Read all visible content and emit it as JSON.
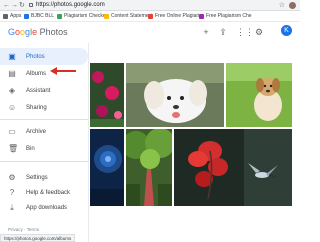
{
  "browser": {
    "url": "https://photos.google.com",
    "bookmarks": [
      {
        "label": "Apps",
        "color": "#5f6368"
      },
      {
        "label": "BJBC BLL",
        "color": "#1a73e8"
      },
      {
        "label": "Plagiarism Checker",
        "color": "#34a853"
      },
      {
        "label": "Content Statement",
        "color": "#fbbc05"
      },
      {
        "label": "Free Online Plagiaris",
        "color": "#ea4335"
      },
      {
        "label": "Free Plagiarism Che",
        "color": "#9c27b0"
      }
    ]
  },
  "app": {
    "logo_google": "Google",
    "logo_photos": "Photos",
    "avatar_initial": "K",
    "header_icons": [
      "plus-icon",
      "upload-icon",
      "grid-icon",
      "settings-icon"
    ]
  },
  "sidebar": {
    "items": [
      {
        "label": "Photos",
        "icon": "photo-icon",
        "active": true
      },
      {
        "label": "Albums",
        "icon": "album-icon",
        "active": false
      },
      {
        "label": "Assistant",
        "icon": "assistant-icon",
        "active": false
      },
      {
        "label": "Sharing",
        "icon": "sharing-icon",
        "active": false
      },
      {
        "label": "Archive",
        "icon": "archive-icon",
        "active": false
      },
      {
        "label": "Bin",
        "icon": "bin-icon",
        "active": false
      },
      {
        "label": "Settings",
        "icon": "gear-icon",
        "active": false
      },
      {
        "label": "Help & feedback",
        "icon": "help-icon",
        "active": false
      },
      {
        "label": "App downloads",
        "icon": "download-icon",
        "active": false
      }
    ],
    "footer": {
      "privacy": "Privacy",
      "separator": "·",
      "terms": "Terms"
    }
  },
  "status_bar": {
    "url": "https://photos.google.com/albums"
  },
  "annotation": {
    "arrow_color": "#d93025",
    "points_to": "Albums"
  },
  "colors": {
    "accent": "#1a73e8",
    "active_bg": "#e8f0fe"
  }
}
